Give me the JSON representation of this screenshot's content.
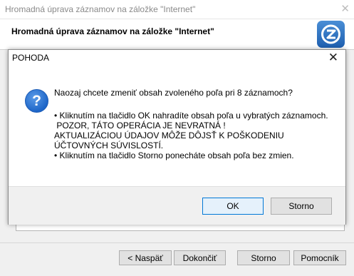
{
  "wizard": {
    "window_title": "Hromadná úprava záznamov na záložke \"Internet\"",
    "close_glyph": "✕",
    "heading": "Hromadná úprava záznamov na záložke \"Internet\"",
    "logo_icon": "pohoda-logo-icon",
    "buttons": {
      "back": "< Naspäť",
      "finish": "Dokončiť",
      "cancel": "Storno",
      "help": "Pomocník"
    }
  },
  "dialog": {
    "title": "POHODA",
    "close_glyph": "✕",
    "icon": "question-icon",
    "icon_glyph": "?",
    "question": "Naozaj chcete zmeniť obsah zvoleného poľa pri 8 záznamoch?",
    "line1": "• Kliknutím na tlačidlo OK nahradíte obsah poľa u vybratých záznamoch.",
    "line2": " POZOR, TÁTO OPERÁCIA JE NEVRATNÁ !",
    "line3": "AKTUALIZÁCIOU ÚDAJOV MÔŽE DÔJSŤ K POŠKODENIU ÚČTOVNÝCH SÚVISLOSTÍ.",
    "line4": "• Kliknutím na tlačidlo Storno ponecháte obsah poľa bez zmien.",
    "ok_label": "OK",
    "storno_label": "Storno"
  }
}
